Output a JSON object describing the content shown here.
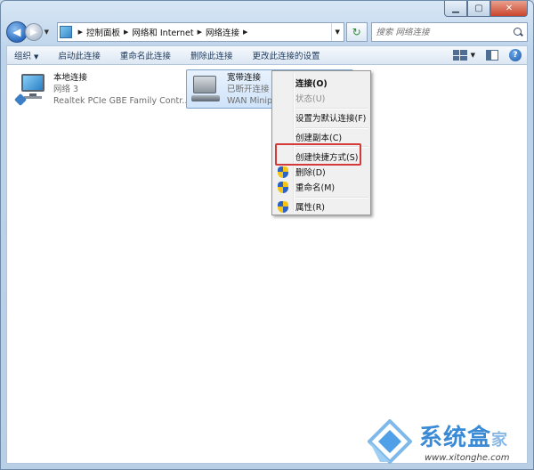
{
  "window": {
    "caption": {
      "minimize": "▁",
      "maximize": "▢",
      "close": "✕"
    }
  },
  "address": {
    "crumbs": [
      "控制面板",
      "网络和 Internet",
      "网络连接"
    ],
    "search_placeholder": "搜索 网络连接"
  },
  "toolbar": {
    "items": [
      "组织",
      "启动此连接",
      "重命名此连接",
      "删除此连接",
      "更改此连接的设置"
    ],
    "help": "?"
  },
  "connections": [
    {
      "name": "本地连接",
      "status": "网络  3",
      "device": "Realtek PCIe GBE Family Contr..."
    },
    {
      "name": "宽带连接",
      "status": "已断开连接",
      "device": "WAN Minipo"
    }
  ],
  "context_menu": {
    "items": [
      {
        "label": "连接(O)",
        "bold": true
      },
      {
        "label": "状态(U)",
        "disabled": true
      },
      {
        "label": "设置为默认连接(F)"
      },
      {
        "label": "创建副本(C)"
      },
      {
        "label": "创建快捷方式(S)"
      },
      {
        "label": "删除(D)",
        "shield": true
      },
      {
        "label": "重命名(M)",
        "shield": true
      },
      {
        "label": "属性(R)",
        "shield": true
      }
    ],
    "highlighted_item": "创建快捷方式(S)"
  },
  "watermark": {
    "title": "系统盒",
    "title_suffix": "家",
    "url": "www.xitonghe.com"
  },
  "colors": {
    "highlight_box": "#d43a3a",
    "accent": "#3a8ad6"
  }
}
